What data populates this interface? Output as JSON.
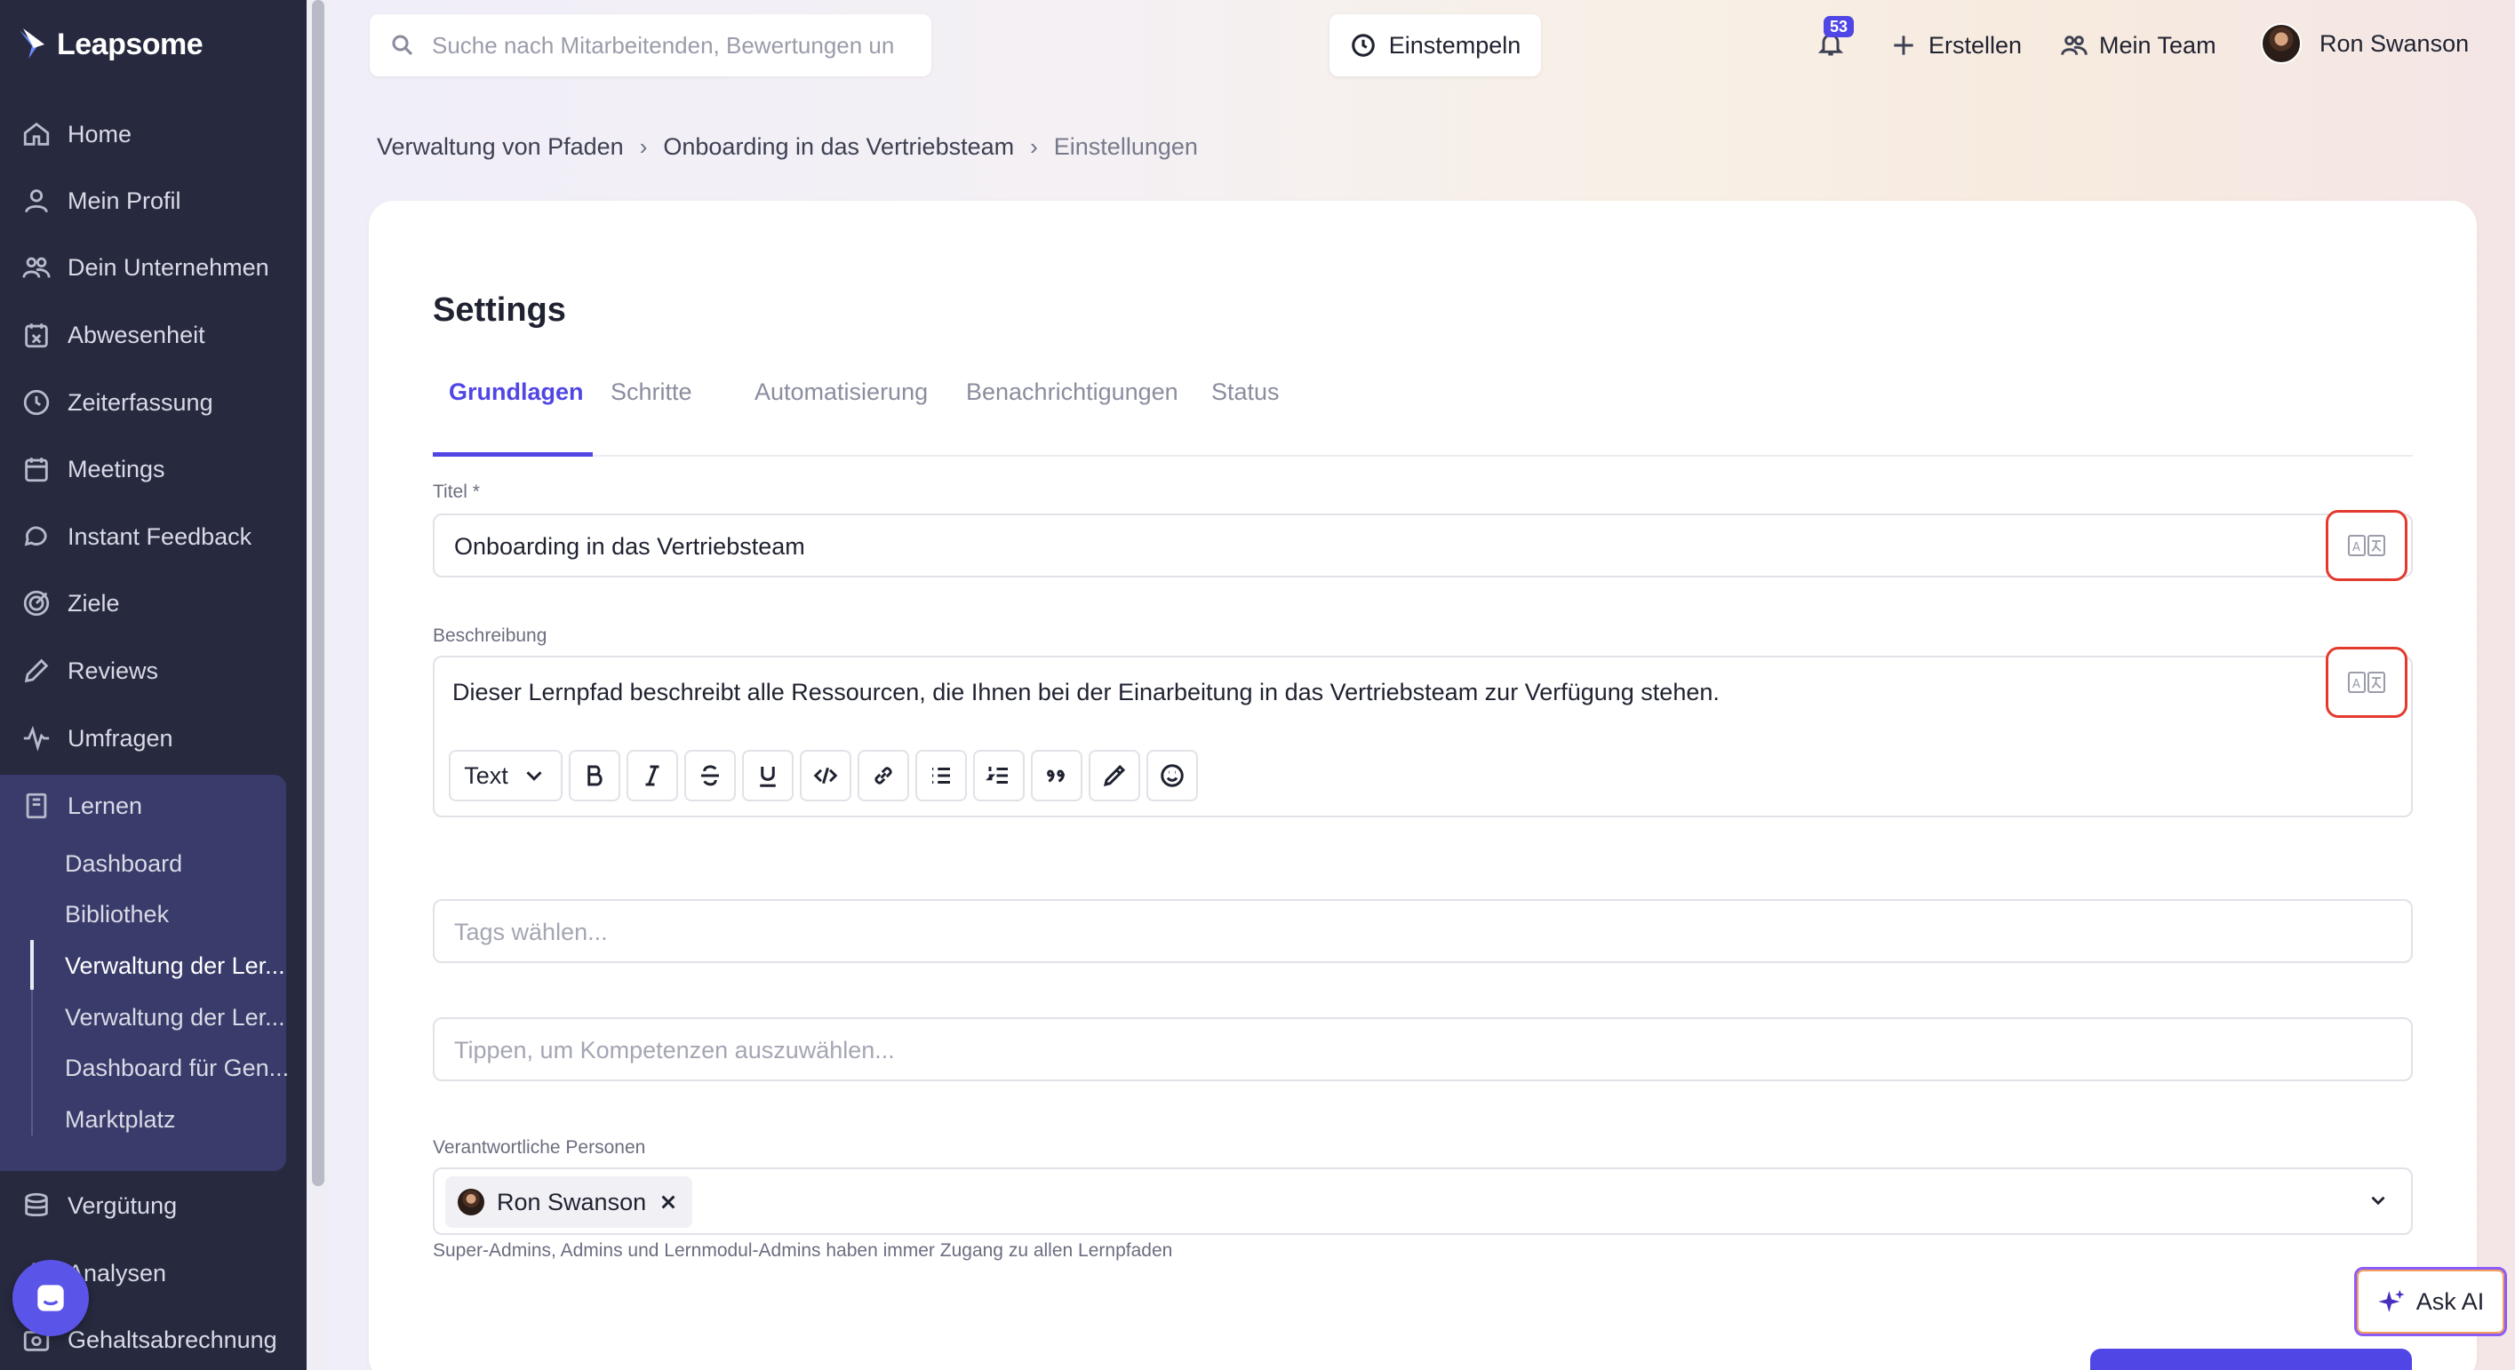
{
  "sidebar": {
    "brand": "Leapsome",
    "items": [
      {
        "label": "Home",
        "icon": "home-icon"
      },
      {
        "label": "Mein Profil",
        "icon": "user-icon"
      },
      {
        "label": "Dein Unternehmen",
        "icon": "people-icon"
      },
      {
        "label": "Abwesenheit",
        "icon": "calendar-x-icon"
      },
      {
        "label": "Zeiterfassung",
        "icon": "clock-icon"
      },
      {
        "label": "Meetings",
        "icon": "calendar-icon"
      },
      {
        "label": "Instant Feedback",
        "icon": "chat-icon"
      },
      {
        "label": "Ziele",
        "icon": "target-icon"
      },
      {
        "label": "Reviews",
        "icon": "pencil-icon"
      },
      {
        "label": "Umfragen",
        "icon": "pulse-icon"
      },
      {
        "label": "Lernen",
        "icon": "book-icon"
      },
      {
        "label": "Vergütung",
        "icon": "coins-icon"
      },
      {
        "label": "Analysen",
        "icon": "chart-icon"
      },
      {
        "label": "Gehaltsabrechnung",
        "icon": "payroll-icon"
      }
    ],
    "learn_sub": [
      {
        "label": "Dashboard"
      },
      {
        "label": "Bibliothek"
      },
      {
        "label": "Verwaltung der Ler..."
      },
      {
        "label": "Verwaltung der Ler..."
      },
      {
        "label": "Dashboard für Gen..."
      },
      {
        "label": "Marktplatz"
      }
    ]
  },
  "header": {
    "search_placeholder": "Suche nach Mitarbeitenden, Bewertungen un",
    "clock_in_label": "Einstempeln",
    "notification_count": "53",
    "create_label": "Erstellen",
    "team_label": "Mein Team",
    "user_name": "Ron Swanson"
  },
  "breadcrumb": {
    "items": [
      "Verwaltung von Pfaden",
      "Onboarding in das Vertriebsteam",
      "Einstellungen"
    ]
  },
  "settings": {
    "title": "Settings",
    "tabs": [
      "Grundlagen",
      "Schritte",
      "Automatisierung",
      "Benachrichtigungen",
      "Status"
    ],
    "active_tab": "Grundlagen",
    "title_label": "Titel *",
    "title_value": "Onboarding in das Vertriebsteam",
    "description_label": "Beschreibung",
    "description_value": "Dieser Lernpfad beschreibt alle Ressourcen, die Ihnen bei der Einarbeitung in das Vertriebsteam zur Verfügung stehen.",
    "text_style_label": "Text",
    "tags_placeholder": "Tags wählen...",
    "skills_placeholder": "Tippen, um Kompetenzen auszuwählen...",
    "owners_label": "Verantwortliche Personen",
    "owner_chip": "Ron Swanson",
    "owners_hint": "Super-Admins, Admins und Lernmodul-Admins haben immer Zugang zu allen Lernpfaden"
  },
  "ask_ai_label": "Ask AI",
  "colors": {
    "sidebar_bg": "#272a3f",
    "accent": "#4f46e5",
    "highlight_border": "#e23b2e"
  }
}
